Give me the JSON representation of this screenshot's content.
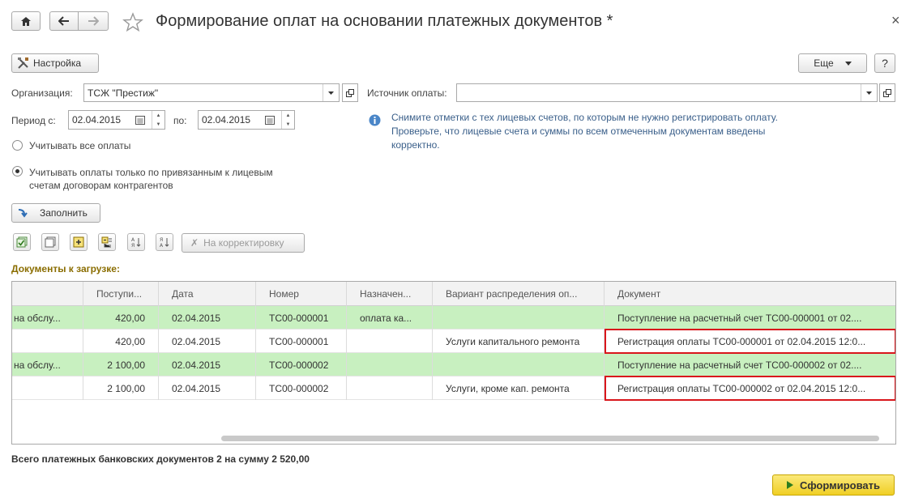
{
  "header": {
    "title": "Формирование оплат на основании платежных документов *",
    "close_glyph": "×"
  },
  "toolbar_top": {
    "settings_label": "Настройка",
    "more_label": "Еще",
    "help_label": "?"
  },
  "form": {
    "org_label": "Организация:",
    "org_value": "ТСЖ \"Престиж\"",
    "source_label": "Источник оплаты:",
    "source_value": "",
    "period_from_label": "Период с:",
    "period_from_value": "02.04.2015",
    "period_to_label": "по:",
    "period_to_value": "02.04.2015",
    "radio_all_label": "Учитывать все оплаты",
    "radio_linked_label_1": "Учитывать оплаты только по привязанным к лицевым",
    "radio_linked_label_2": "счетам договорам контрагентов",
    "info_line_1": "Снимите отметки с тех лицевых счетов, по которым не нужно регистрировать оплату.",
    "info_line_2": "Проверьте, что лицевые счета и суммы по всем отмеченным документам введены",
    "info_line_3": "корректно.",
    "fill_label": "Заполнить",
    "correct_label": "На корректировку"
  },
  "section_title": "Документы к загрузке:",
  "table": {
    "columns": [
      "",
      "Поступи...",
      "Дата",
      "Номер",
      "Назначен...",
      "Вариант распределения оп...",
      "Документ"
    ],
    "rows": [
      {
        "c0": "на обслу...",
        "c1": "420,00",
        "c2": "02.04.2015",
        "c3": "ТС00-000001",
        "c4": "оплата ка...",
        "c5": "",
        "c6": "Поступление на расчетный счет ТС00-000001 от 02....",
        "green": true
      },
      {
        "c0": "",
        "c1": "420,00",
        "c2": "02.04.2015",
        "c3": "ТС00-000001",
        "c4": "",
        "c5": "Услуги капитального ремонта",
        "c6": "Регистрация оплаты ТС00-000001 от 02.04.2015 12:0...",
        "green": false
      },
      {
        "c0": "на обслу...",
        "c1": "2 100,00",
        "c2": "02.04.2015",
        "c3": "ТС00-000002",
        "c4": "",
        "c5": "",
        "c6": "Поступление на расчетный счет ТС00-000002 от 02....",
        "green": true
      },
      {
        "c0": "",
        "c1": "2 100,00",
        "c2": "02.04.2015",
        "c3": "ТС00-000002",
        "c4": "",
        "c5": "Услуги, кроме кап. ремонта",
        "c6": "Регистрация оплаты ТС00-000002 от 02.04.2015 12:0...",
        "green": false
      }
    ]
  },
  "footer": {
    "total_text": "Всего платежных банковских документов 2 на сумму 2 520,00",
    "submit_label": "Сформировать"
  },
  "colors": {
    "green_row": "#c8f0c0",
    "highlight": "#d9161c",
    "submit_bg": "#f5dc3c",
    "section_title": "#8a6d00",
    "info_text": "#3a5f8a"
  }
}
